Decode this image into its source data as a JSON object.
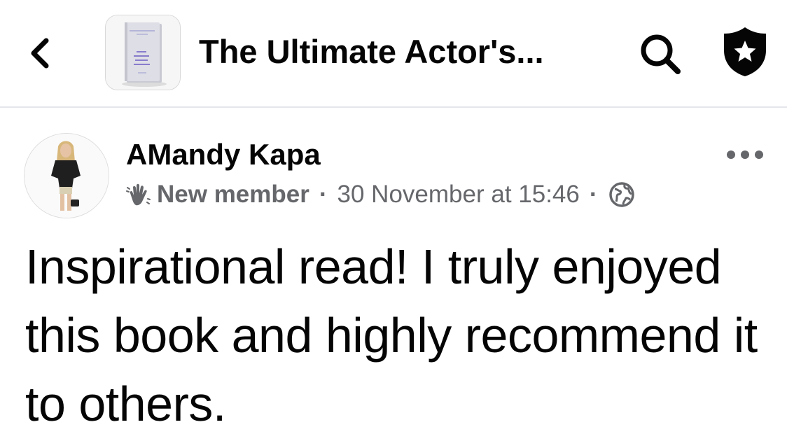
{
  "header": {
    "group_title": "The Ultimate Actor's...",
    "thumbnail_icon": "book-cover-thumbnail",
    "back_icon": "chevron-left-icon",
    "search_icon": "search-icon",
    "shield_icon": "shield-star-icon"
  },
  "post": {
    "author": "AMandy Kapa",
    "badge_label": "New member",
    "badge_icon": "wave-hand-icon",
    "separator": "·",
    "timestamp": "30 November at 15:46",
    "privacy_icon": "globe-icon",
    "more_icon": "more-options-icon",
    "body": "Inspirational read! I truly enjoyed this book and highly recommend it to others."
  },
  "colors": {
    "text_primary": "#050505",
    "text_secondary": "#65676b",
    "divider": "#e4e6eb"
  }
}
